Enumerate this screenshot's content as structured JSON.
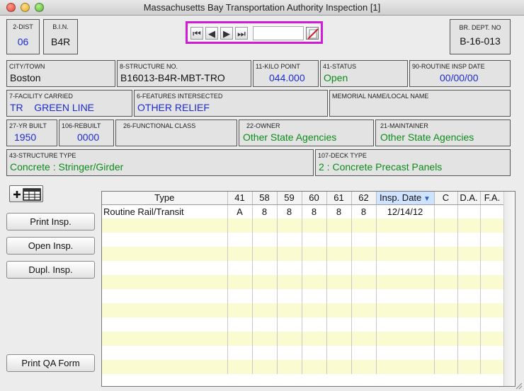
{
  "window": {
    "title": "Massachusetts Bay Transportation Authority Inspection [1]"
  },
  "header": {
    "dist": {
      "label": "2-DIST",
      "value": "06"
    },
    "bin": {
      "label": "B.I.N.",
      "value": "B4R"
    },
    "br_dept": {
      "label": "BR. DEPT. NO",
      "value": "B-16-013"
    }
  },
  "fields": {
    "city": {
      "label": "CITY/TOWN",
      "value": "Boston"
    },
    "structure_no": {
      "label": "8-STRUCTURE NO.",
      "value": "B16013-B4R-MBT-TRO"
    },
    "kilo_point": {
      "label": "11-KILO POINT",
      "value": "044.000"
    },
    "status": {
      "label": "41-STATUS",
      "value": "Open"
    },
    "routine_insp_date": {
      "label": "90-ROUTINE INSP DATE",
      "value": "00/00/00"
    },
    "facility_carried": {
      "label": "7-FACILITY CARRIED",
      "value": "TR    GREEN LINE"
    },
    "features_intersected": {
      "label": "6-FEATURES INTERSECTED",
      "value": "OTHER RELIEF"
    },
    "memorial_name": {
      "label": "MEMORIAL NAME/LOCAL NAME",
      "value": ""
    },
    "yr_built": {
      "label": "27-YR BUILT",
      "value": "1950"
    },
    "rebuilt": {
      "label": "106-REBUILT",
      "value": "0000"
    },
    "functional_class": {
      "label": "26-FUNCTIONAL CLASS",
      "value": ""
    },
    "owner": {
      "label": "22-OWNER",
      "value": "Other State Agencies"
    },
    "maintainer": {
      "label": "21-MAINTAINER",
      "value": "Other State Agencies"
    },
    "structure_type": {
      "label": "43-STRUCTURE TYPE",
      "value": "Concrete : Stringer/Girder"
    },
    "deck_type": {
      "label": "107-DECK TYPE",
      "value": "2 : Concrete Precast Panels"
    }
  },
  "buttons": {
    "print_insp": "Print Insp.",
    "open_insp": "Open Insp.",
    "dupl_insp": "Dupl. Insp.",
    "print_qa": "Print QA Form"
  },
  "nav_icons": [
    "first-record-icon",
    "previous-record-icon",
    "next-record-icon",
    "last-record-icon",
    "delete-record-icon"
  ],
  "table": {
    "columns": [
      "Type",
      "41",
      "58",
      "59",
      "60",
      "61",
      "62",
      "Insp. Date",
      "C",
      "D.A.",
      "F.A."
    ],
    "sorted_column": "Insp. Date",
    "rows": [
      [
        "Routine Rail/Transit",
        "A",
        "8",
        "8",
        "8",
        "8",
        "8",
        "12/14/12",
        "",
        "",
        ""
      ]
    ]
  },
  "colors": {
    "value_blue": "#1a2bd6",
    "value_green": "#0c8c1a",
    "row_alt": "#fbfbd2",
    "nav_highlight": "#d21bd6"
  }
}
